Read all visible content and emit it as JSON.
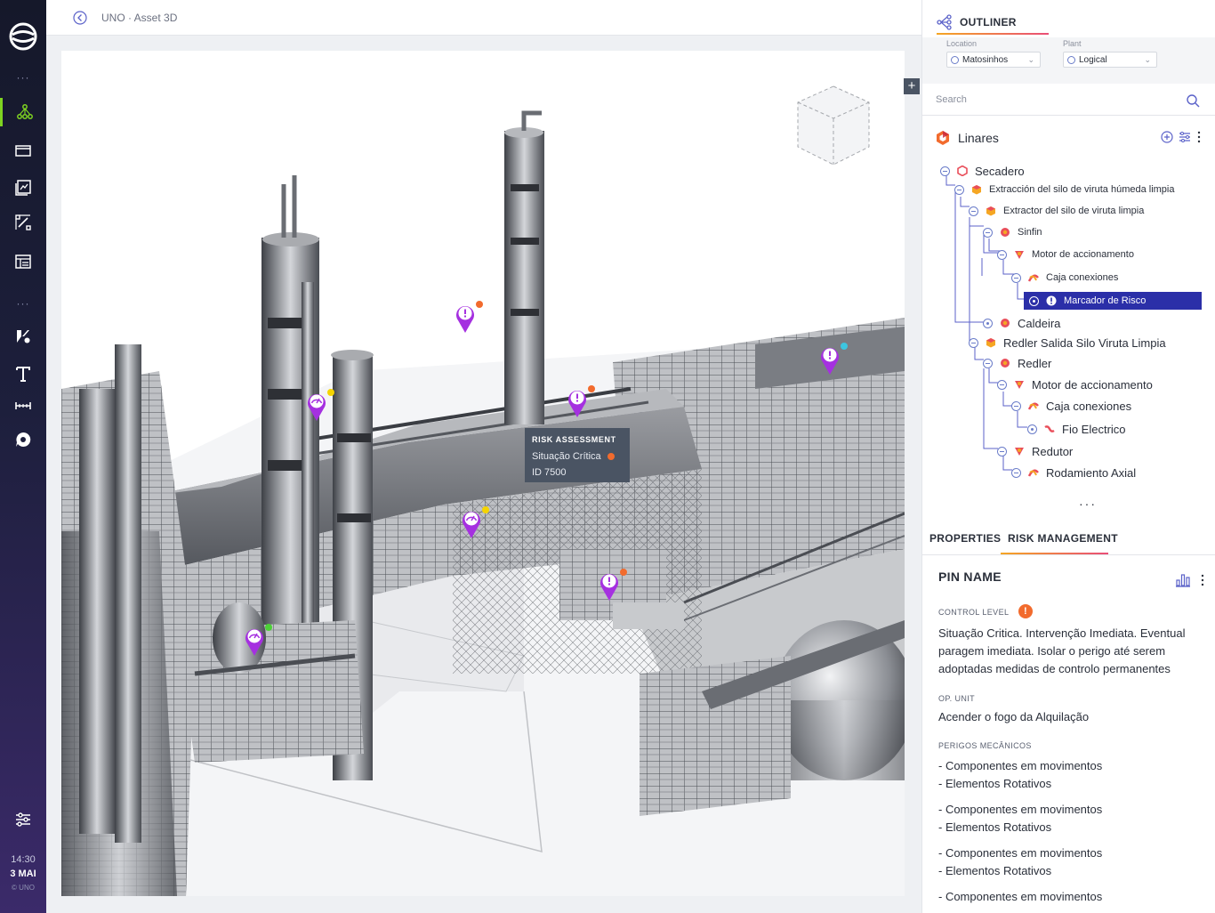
{
  "app": {
    "breadcrumb": "UNO · Asset 3D"
  },
  "rail": {
    "dots_top": "···",
    "dots_mid": "···",
    "clock_time": "14:30",
    "clock_date": "3 MAI",
    "copyright": "© UNO",
    "active_color": "#7ed321"
  },
  "tooltip": {
    "title": "RISK ASSESSMENT",
    "status": "Situação Crítica",
    "id": "ID 7500"
  },
  "pins": [
    {
      "type": "alert",
      "status_color": "#f26b2d"
    },
    {
      "type": "gauge",
      "status_color": "#f5d400"
    },
    {
      "type": "alert",
      "status_color": "#f26b2d"
    },
    {
      "type": "alert",
      "status_color": "#3cc6e0"
    },
    {
      "type": "gauge",
      "status_color": "#f5d400"
    },
    {
      "type": "alert",
      "status_color": "#f26b2d"
    },
    {
      "type": "gauge",
      "status_color": "#4cd137"
    }
  ],
  "viewport_add_label": "+",
  "outliner": {
    "tab_label": "OUTLINER",
    "location_label": "Location",
    "location_value": "Matosinhos",
    "plant_label": "Plant",
    "plant_value": "Logical",
    "search_placeholder": "Search",
    "root": "Linares",
    "nodes": [
      "Secadero",
      "Extracción del silo de viruta húmeda limpia",
      "Extractor del silo de viruta limpia",
      "Sinfin",
      "Motor de accionamento",
      "Caja conexiones",
      "Marcador de Risco",
      "Caldeira",
      "Redler Salida Silo Viruta Limpia",
      "Redler",
      "Motor de accionamento",
      "Caja conexiones",
      "Fio Electrico",
      "Redutor",
      "Rodamiento Axial"
    ],
    "more": "···"
  },
  "detail_tabs": {
    "properties": "PROPERTIES",
    "risk": "RISK MANAGEMENT"
  },
  "detail": {
    "pin_name": "PIN NAME",
    "control_level_label": "CONTROL LEVEL",
    "control_level_icon": "!",
    "control_text": "Situação Critica. Intervenção Imediata. Eventual paragem imediata. Isolar o perigo até serem adoptadas medidas de controlo permanentes",
    "op_unit_label": "OP. UNIT",
    "op_unit_value": "Acender o fogo da Alquilação",
    "hazards_label": "PERIGOS MECÂNICOS",
    "hazards": [
      [
        "- Componentes em movimentos",
        "- Elementos Rotativos"
      ],
      [
        "- Componentes em movimentos",
        "- Elementos Rotativos"
      ],
      [
        "- Componentes em movimentos",
        "- Elementos Rotativos"
      ],
      [
        "- Componentes em movimentos"
      ]
    ]
  }
}
